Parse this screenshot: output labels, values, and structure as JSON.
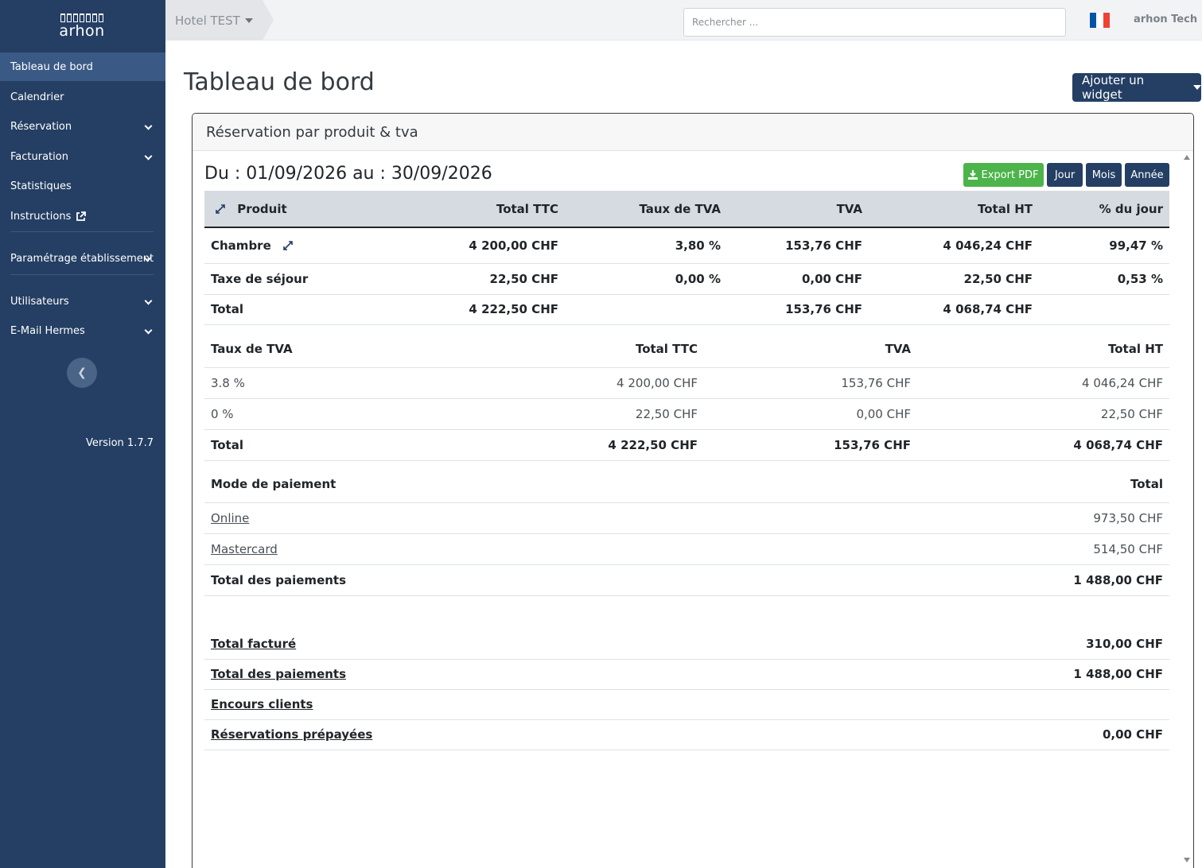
{
  "sidebar": {
    "logo": "arhon",
    "items": [
      {
        "label": "Tableau de bord"
      },
      {
        "label": "Calendrier"
      },
      {
        "label": "Réservation"
      },
      {
        "label": "Facturation"
      },
      {
        "label": "Statistiques"
      },
      {
        "label": "Instructions"
      },
      {
        "label": "Paramétrage établissement"
      },
      {
        "label": "Utilisateurs"
      },
      {
        "label": "E-Mail Hermes"
      }
    ],
    "version": "Version 1.7.7"
  },
  "topbar": {
    "hotel": "Hotel TEST",
    "search_placeholder": "Rechercher ...",
    "user": "arhon Tech",
    "flag_colors": [
      "#0055a4",
      "#ffffff",
      "#ef4135"
    ]
  },
  "page": {
    "title": "Tableau de bord",
    "add_widget": "Ajouter un widget"
  },
  "widget": {
    "title": "Réservation par produit & tva",
    "range": "Du : 01/09/2026 au : 30/09/2026",
    "buttons": {
      "pdf": "Export PDF",
      "jour": "Jour",
      "mois": "Mois",
      "annee": "Année"
    },
    "products": {
      "headers": [
        "Produit",
        "Total TTC",
        "Taux de TVA",
        "TVA",
        "Total HT",
        "% du jour"
      ],
      "rows": [
        [
          "Chambre",
          "4 200,00 CHF",
          "3,80 %",
          "153,76 CHF",
          "4 046,24 CHF",
          "99,47 %"
        ],
        [
          "Taxe de séjour",
          "22,50 CHF",
          "0,00 %",
          "0,00 CHF",
          "22,50 CHF",
          "0,53 %"
        ],
        [
          "Total",
          "4 222,50 CHF",
          "",
          "153,76 CHF",
          "4 068,74 CHF",
          ""
        ]
      ]
    },
    "vat": {
      "headers": [
        "Taux de TVA",
        "Total TTC",
        "TVA",
        "Total HT"
      ],
      "rows": [
        [
          "3.8 %",
          "4 200,00 CHF",
          "153,76 CHF",
          "4 046,24 CHF"
        ],
        [
          "0 %",
          "22,50 CHF",
          "0,00 CHF",
          "22,50 CHF"
        ],
        [
          "Total",
          "4 222,50 CHF",
          "153,76 CHF",
          "4 068,74 CHF"
        ]
      ]
    },
    "payments": {
      "headers": [
        "Mode de paiement",
        "Total"
      ],
      "rows": [
        [
          "Online",
          "973,50 CHF"
        ],
        [
          "Mastercard",
          "514,50 CHF"
        ],
        [
          "Total des paiements",
          "1 488,00 CHF"
        ]
      ]
    },
    "summary": [
      [
        "Total facturé",
        "310,00 CHF"
      ],
      [
        "Total des paiements",
        "1 488,00 CHF"
      ],
      [
        "Encours clients",
        ""
      ],
      [
        "Réservations prépayées",
        "0,00 CHF"
      ]
    ]
  },
  "colors": {
    "sidebar_bg": "#243f63",
    "active_item": "#3a5a85",
    "pdf_button": "#4cb44a",
    "period_button": "#243f63",
    "table_header_bg": "#d6dbe1"
  },
  "icons": [
    "chevron-down-icon",
    "external-link-icon",
    "chevron-left-icon",
    "expand-icon",
    "download-icon",
    "caret-down-icon",
    "france-flag-icon"
  ]
}
